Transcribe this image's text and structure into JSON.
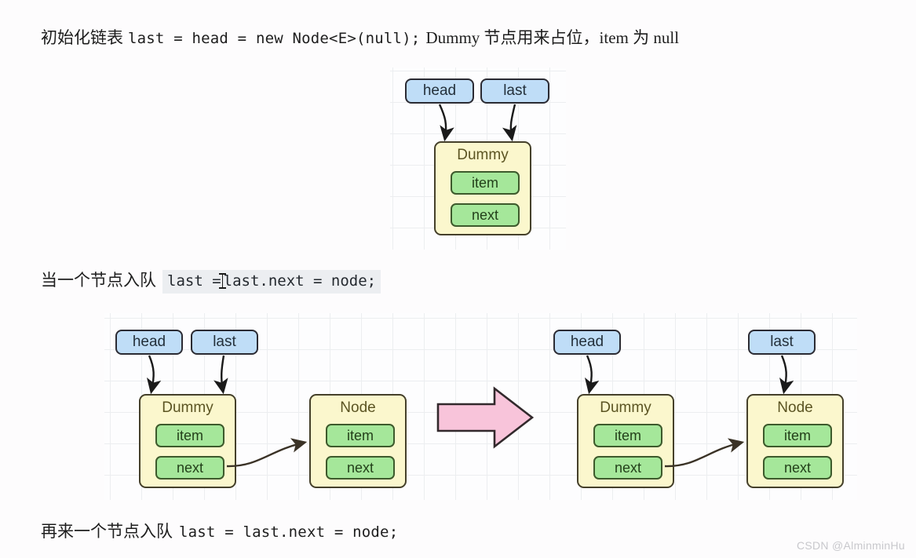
{
  "lines": {
    "line1": {
      "cn_prefix": "初始化链表",
      "code": "last = head = new Node<E>(null);",
      "serif_suffix": "Dummy 节点用来占位，item 为 null"
    },
    "line2": {
      "cn_prefix": "当一个节点入队",
      "code_before_caret": "last =",
      "code_after_caret": "last.next = node;"
    },
    "line3": {
      "cn_prefix": "再来一个节点入队",
      "code": "last = last.next = node;"
    }
  },
  "diagram1": {
    "pointers": [
      {
        "label": "head"
      },
      {
        "label": "last"
      }
    ],
    "nodes": [
      {
        "title": "Dummy",
        "fields": [
          {
            "label": "item"
          },
          {
            "label": "next"
          }
        ]
      }
    ]
  },
  "diagram2": {
    "before": {
      "pointers": [
        {
          "label": "head"
        },
        {
          "label": "last"
        }
      ],
      "nodes": [
        {
          "title": "Dummy",
          "fields": [
            {
              "label": "item"
            },
            {
              "label": "next"
            }
          ]
        },
        {
          "title": "Node",
          "fields": [
            {
              "label": "item"
            },
            {
              "label": "next"
            }
          ]
        }
      ]
    },
    "transition_arrow": "right-arrow-pink",
    "after": {
      "pointers": [
        {
          "label": "head"
        },
        {
          "label": "last"
        }
      ],
      "nodes": [
        {
          "title": "Dummy",
          "fields": [
            {
              "label": "item"
            },
            {
              "label": "next"
            }
          ]
        },
        {
          "title": "Node",
          "fields": [
            {
              "label": "item"
            },
            {
              "label": "next"
            }
          ]
        }
      ]
    }
  },
  "watermark": {
    "text": "CSDN @AlminminHu"
  },
  "colors": {
    "pointer_fill": "#bfddf7",
    "node_fill": "#fbf7cd",
    "field_fill": "#a5e79a",
    "arrow_pink": "#f8c4da",
    "stroke_dark": "#2b2b33",
    "grid_line": "#eceef0",
    "page_bg": "#fdfcfd",
    "code_highlight_bg": "#eceef1"
  }
}
